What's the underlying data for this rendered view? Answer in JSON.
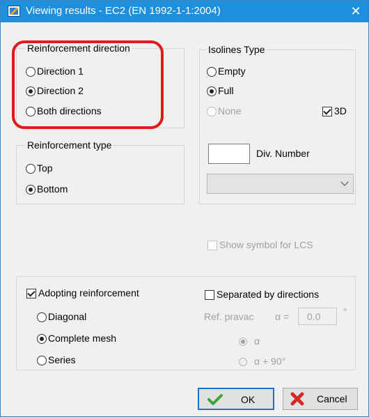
{
  "window": {
    "title": "Viewing results - EC2 (EN 1992-1-1:2004)",
    "close_glyph": "✕"
  },
  "reinforcement_direction": {
    "title": "Reinforcement direction",
    "options": [
      {
        "label": "Direction 1",
        "selected": false
      },
      {
        "label": "Direction 2",
        "selected": true
      },
      {
        "label": "Both directions",
        "selected": false
      }
    ]
  },
  "isolines_type": {
    "title": "Isolines Type",
    "options": [
      {
        "label": "Empty",
        "selected": false
      },
      {
        "label": "Full",
        "selected": true
      },
      {
        "label": "None",
        "selected": false,
        "disabled": true
      }
    ],
    "checkbox_3d": {
      "label": "3D",
      "checked": true
    },
    "div_number": {
      "value": "",
      "label": "Div. Number"
    },
    "combo_value": ""
  },
  "reinforcement_type": {
    "title": "Reinforcement type",
    "options": [
      {
        "label": "Top",
        "selected": false
      },
      {
        "label": "Bottom",
        "selected": true
      }
    ]
  },
  "show_symbol_lcs": {
    "label": "Show symbol for LCS",
    "checked": false,
    "disabled": true
  },
  "adopting": {
    "label": "Adopting reinforcement",
    "checked": true,
    "options": [
      {
        "label": "Diagonal",
        "selected": false
      },
      {
        "label": "Complete mesh",
        "selected": true
      },
      {
        "label": "Series",
        "selected": false
      }
    ]
  },
  "separated": {
    "label": "Separated by directions",
    "checked": false,
    "ref_label": "Ref. pravac",
    "alpha_eq": "α =",
    "alpha_value": "0.0",
    "degree": "°",
    "alpha_opt1": "α",
    "alpha_opt2": "α + 90°"
  },
  "buttons": {
    "ok": "OK",
    "cancel": "Cancel"
  },
  "colors": {
    "title_bar": "#1e8fdc",
    "highlight_ring": "#e31a1a",
    "ok_check": "#3aa63a",
    "cancel_x": "#d62828"
  }
}
